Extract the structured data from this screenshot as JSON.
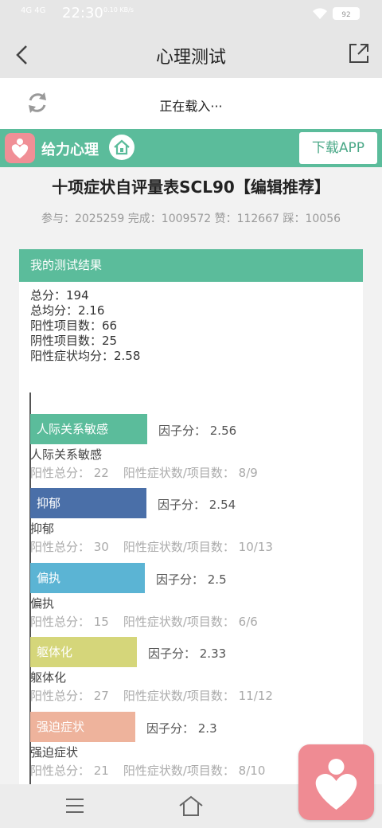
{
  "status": {
    "network": "4G 4G",
    "time": "22:30",
    "speed": "0.10 KB/s",
    "battery": "92"
  },
  "nav": {
    "title": "心理测试"
  },
  "loading": {
    "text": "正在载入···"
  },
  "brand": {
    "name": "给力心理",
    "download_label": "下载APP",
    "color": "#5bbc9b"
  },
  "test": {
    "title": "十项症状自评量表SCL90【编辑推荐】",
    "stats": "参与：2025259 完成：1009572 赞：112667 踩：10056"
  },
  "result": {
    "header": "我的测试结果",
    "summary": [
      "总分：194",
      "总均分：2.16",
      "阳性项目数：66",
      "阴性项目数：25",
      "阳性症状均分：2.58"
    ],
    "factors": [
      {
        "bar_label": "人际关系敏感",
        "score_text": "因子分：  2.56",
        "score": 2.56,
        "name": "人际关系敏感",
        "positive_total": "阳性总分：  22",
        "positive_ratio": "阳性症状数/项目数：  8/9",
        "color": "#5bbc9b"
      },
      {
        "bar_label": "抑郁",
        "score_text": "因子分：  2.54",
        "score": 2.54,
        "name": "抑郁",
        "positive_total": "阳性总分：  30",
        "positive_ratio": "阳性症状数/项目数：  10/13",
        "color": "#4a6fa8"
      },
      {
        "bar_label": "偏执",
        "score_text": "因子分：  2.5",
        "score": 2.5,
        "name": "偏执",
        "positive_total": "阳性总分：  15",
        "positive_ratio": "阳性症状数/项目数：  6/6",
        "color": "#5bb4d4"
      },
      {
        "bar_label": "躯体化",
        "score_text": "因子分：  2.33",
        "score": 2.33,
        "name": "躯体化",
        "positive_total": "阳性总分：  27",
        "positive_ratio": "阳性症状数/项目数：  11/12",
        "color": "#d5d67a"
      },
      {
        "bar_label": "强迫症状",
        "score_text": "因子分：  2.3",
        "score": 2.3,
        "name": "强迫症状",
        "positive_total": "阳性总分：  21",
        "positive_ratio": "阳性症状数/项目数：  8/10",
        "color": "#eeb39c"
      }
    ]
  },
  "icons": {
    "back": "chevron-left-icon",
    "share": "share-icon",
    "refresh": "refresh-icon",
    "home": "home-icon",
    "menu": "menu-icon",
    "app_logo": "heart-person-logo"
  }
}
